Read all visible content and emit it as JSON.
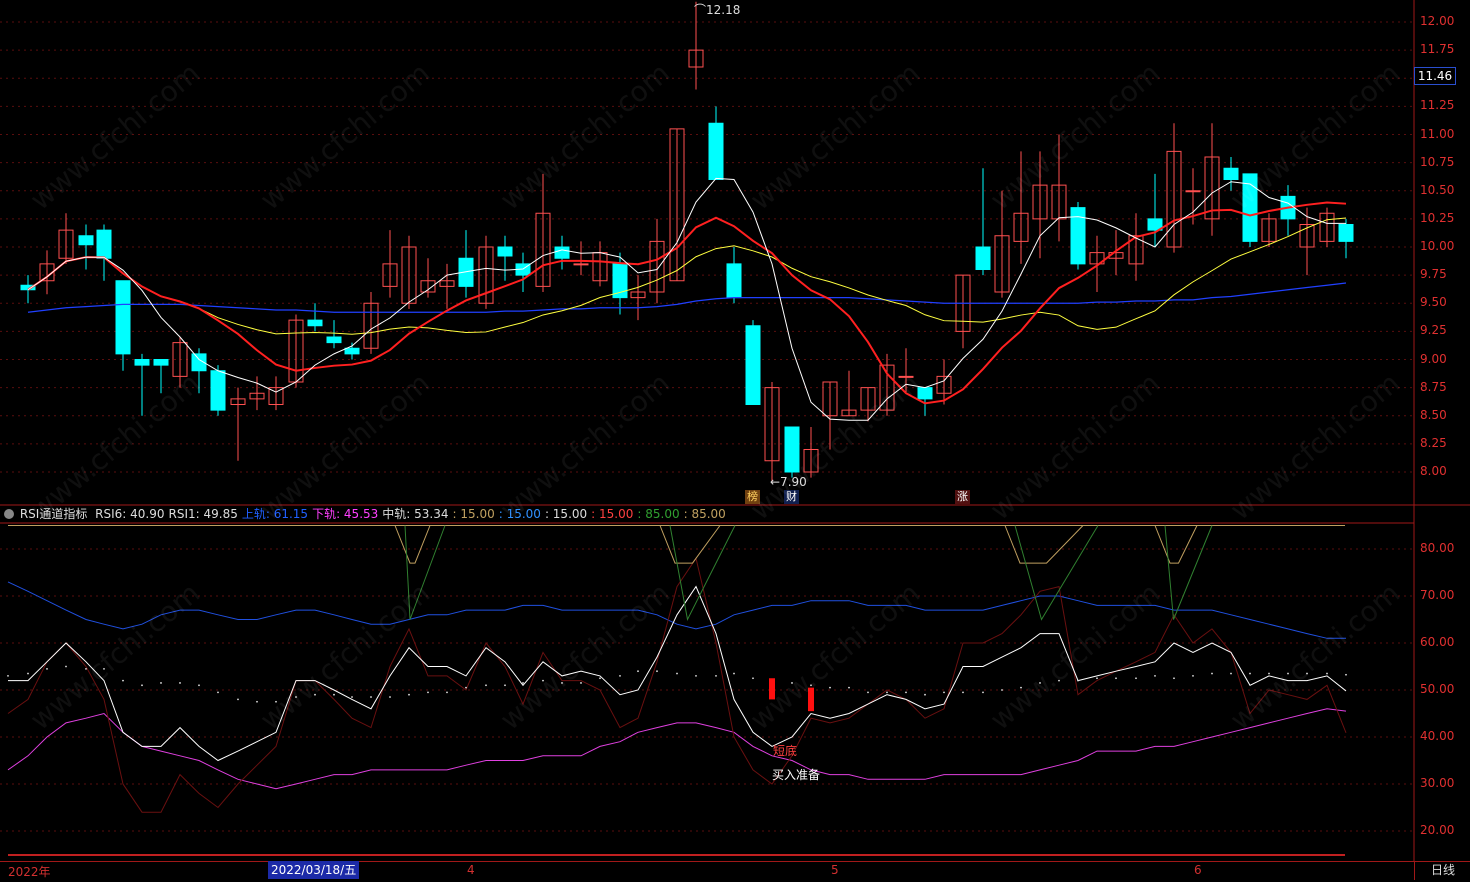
{
  "price_axis": {
    "ticks": [
      "12.00",
      "11.75",
      "11.50",
      "11.25",
      "11.00",
      "10.75",
      "10.50",
      "10.25",
      "10.00",
      "9.75",
      "9.50",
      "9.25",
      "9.00",
      "8.75",
      "8.50",
      "8.25",
      "8.00"
    ]
  },
  "rsi_axis": {
    "ticks": [
      "80.00",
      "70.00",
      "60.00",
      "50.00",
      "40.00",
      "30.00",
      "20.00"
    ]
  },
  "current_price": "11.46",
  "annotations": {
    "high": "12.18",
    "low": "←7.90",
    "buy_ready": "买入准备",
    "buy_tag": "短底",
    "markers": [
      "榜",
      "财",
      "涨"
    ]
  },
  "legend": {
    "name": "RSI通道指标",
    "items": [
      {
        "text": "RSI6: 40.90",
        "color": "#dddddd"
      },
      {
        "text": "RSI1: 49.85",
        "color": "#dddddd"
      },
      {
        "text": "上轨: 61.15",
        "color": "#2060ff"
      },
      {
        "text": "下轨: 45.53",
        "color": "#ff40ff"
      },
      {
        "text": "中轨: 53.34",
        "color": "#dddddd"
      },
      {
        "text": ": 15.00",
        "color": "#c0a060"
      },
      {
        "text": ": 15.00",
        "color": "#3090ff"
      },
      {
        "text": ": 15.00",
        "color": "#dddddd"
      },
      {
        "text": ": 15.00",
        "color": "#ff4040"
      },
      {
        "text": ": 85.00",
        "color": "#30a030"
      },
      {
        "text": ": 85.00",
        "color": "#c0a060"
      }
    ]
  },
  "dates": {
    "year": "2022年",
    "selected": "2022/03/18/五",
    "m4": "4",
    "m5": "5",
    "m6": "6"
  },
  "period": "日线",
  "watermark": "www.cfchi.com",
  "colors": {
    "up": "#ff5050",
    "down": "#00ffff",
    "ma5": "#ffffff",
    "ma10": "#ffff40",
    "ma20": "#ff2020",
    "ma60": "#2040ff",
    "grid": "#5a0e0e"
  }
}
